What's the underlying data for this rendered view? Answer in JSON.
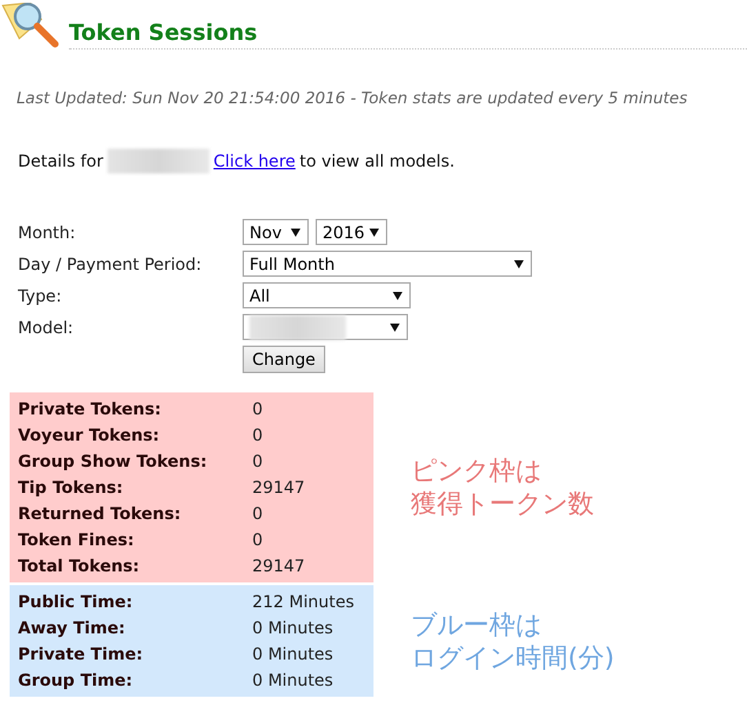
{
  "header": {
    "title": "Token Sessions"
  },
  "last_updated": "Last Updated: Sun Nov 20 21:54:00 2016 - Token stats are updated every 5 minutes",
  "details": {
    "prefix": "Details for",
    "link": "Click here",
    "suffix": "to view all models."
  },
  "form": {
    "fields": [
      {
        "label": "Month:",
        "selects": [
          {
            "value": "Nov"
          },
          {
            "value": "2016"
          }
        ]
      },
      {
        "label": "Day / Payment Period:",
        "selects": [
          {
            "value": "Full Month"
          }
        ]
      },
      {
        "label": "Type:",
        "selects": [
          {
            "value": "All"
          }
        ]
      },
      {
        "label": "Model:",
        "selects": [
          {
            "redacted": true
          }
        ]
      }
    ],
    "button": "Change"
  },
  "stats": [
    {
      "color": "#ffcccc",
      "note": [
        "ピンク枠は",
        "獲得トークン数"
      ],
      "rows": [
        {
          "label": "Private Tokens:",
          "value": "0"
        },
        {
          "label": "Voyeur Tokens:",
          "value": "0"
        },
        {
          "label": "Group Show Tokens:",
          "value": "0"
        },
        {
          "label": "Tip Tokens:",
          "value": "29147"
        },
        {
          "label": "Returned Tokens:",
          "value": "0"
        },
        {
          "label": "Token Fines:",
          "value": "0"
        },
        {
          "label": "Total Tokens:",
          "value": "29147"
        }
      ]
    },
    {
      "color": "#d3e8fc",
      "note": [
        "ブルー枠は",
        "ログイン時間(分)"
      ],
      "rows": [
        {
          "label": "Public Time:",
          "value": "212 Minutes"
        },
        {
          "label": "Away Time:",
          "value": "0 Minutes"
        },
        {
          "label": "Private Time:",
          "value": "0 Minutes"
        },
        {
          "label": "Group Time:",
          "value": "0 Minutes"
        }
      ]
    }
  ]
}
